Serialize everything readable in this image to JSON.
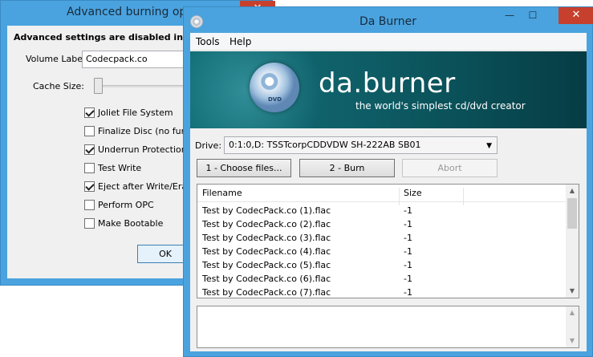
{
  "advanced_dialog": {
    "title": "Advanced burning opti",
    "close_glyph": "✕",
    "header": "Advanced settings are disabled in the",
    "volume_label_label": "Volume Label:",
    "volume_label_value": "Codecpack.co",
    "cache_size_label": "Cache Size:",
    "cache_size_level": 0,
    "options": [
      {
        "label": "Joliet File System",
        "checked": true
      },
      {
        "label": "Finalize Disc (no furthe",
        "checked": false
      },
      {
        "label": "Underrun Protection",
        "checked": true
      },
      {
        "label": "Test Write",
        "checked": false
      },
      {
        "label": "Eject after Write/Erase",
        "checked": true
      },
      {
        "label": "Perform OPC",
        "checked": false
      },
      {
        "label": "Make Bootable",
        "checked": false
      }
    ],
    "ok_label": "OK"
  },
  "main_window": {
    "title": "Da Burner",
    "minimize_glyph": "—",
    "maximize_glyph": "☐",
    "close_glyph": "✕",
    "menu": [
      "Tools",
      "Help"
    ],
    "banner": {
      "brand": "da.burner",
      "tagline": "the world's simplest cd/dvd creator",
      "disc_text": "DVD"
    },
    "drive_label": "Drive:",
    "drive_value": "0:1:0,D: TSSTcorpCDDVDW SH-222AB SB01",
    "buttons": {
      "choose": "1 - Choose files...",
      "burn": "2 - Burn",
      "abort": "Abort"
    },
    "list": {
      "columns": [
        "Filename",
        "Size"
      ],
      "rows": [
        {
          "filename": "Test by CodecPack.co (1).flac",
          "size": "-1"
        },
        {
          "filename": "Test by CodecPack.co (2).flac",
          "size": "-1"
        },
        {
          "filename": "Test by CodecPack.co (3).flac",
          "size": "-1"
        },
        {
          "filename": "Test by CodecPack.co (4).flac",
          "size": "-1"
        },
        {
          "filename": "Test by CodecPack.co (5).flac",
          "size": "-1"
        },
        {
          "filename": "Test by CodecPack.co (6).flac",
          "size": "-1"
        },
        {
          "filename": "Test by CodecPack.co (7).flac",
          "size": "-1"
        }
      ]
    },
    "log_text": ""
  },
  "colors": {
    "window_frame": "#4aa3df",
    "close_button": "#c7402d",
    "banner": "#0f6b74"
  }
}
